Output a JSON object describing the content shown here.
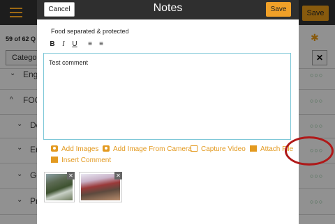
{
  "background": {
    "save_label": "Save",
    "progress_text": "59 of 62 Q",
    "category_label": "Categor",
    "clear_label": "✕",
    "rows": [
      {
        "chevron": "⌄",
        "label": "Eng"
      },
      {
        "chevron": "^",
        "label": "FOC"
      },
      {
        "chevron": "⌄",
        "label": "Do"
      },
      {
        "chevron": "⌄",
        "label": "Er"
      },
      {
        "chevron": "⌄",
        "label": "Go"
      },
      {
        "chevron": "⌄",
        "label": "Pr"
      }
    ],
    "dots": "○○○"
  },
  "modal": {
    "title": "Notes",
    "cancel_label": "Cancel",
    "save_label": "Save",
    "question": "Food separated & protected",
    "toolbar": {
      "bold": "B",
      "italic": "I",
      "underline": "U",
      "ordered_list": "≡",
      "bullet_list": "≡"
    },
    "comment_text": "Test comment",
    "actions": {
      "add_images": "Add Images",
      "add_image_camera": "Add Image From Camera",
      "capture_video": "Capture Video",
      "attach_file": "Attach File",
      "insert_comment": "Insert Comment"
    },
    "thumb_close": "✕"
  },
  "colors": {
    "accent": "#e39a20",
    "header": "#2f2f2f",
    "highlight": "#b01818"
  }
}
